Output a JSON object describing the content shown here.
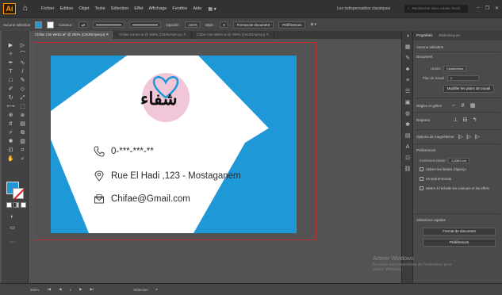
{
  "menubar": {
    "logo": "Ai",
    "items": [
      "Fichier",
      "Edition",
      "Objet",
      "Texte",
      "Sélection",
      "Effet",
      "Affichage",
      "Fenêtre",
      "Aide"
    ],
    "workspace": "Les indispensables classiques",
    "search_placeholder": "Rechercher dans Adobe Stock"
  },
  "controlbar": {
    "selection_label": "Aucune sélection",
    "stroke_label": "Contour :",
    "opacity_label": "Opacité :",
    "opacity_value": "100%",
    "style_label": "Style :",
    "doc_format_button": "Format de document",
    "preferences_button": "Préférences"
  },
  "tabs": [
    {
      "label": "Chifae Cite Web2.ai* @ 200% (CMJN/Aperçu)",
      "active": true
    },
    {
      "label": "Chifae Carte2.ai @ 150% (CMJN/Aperçu)",
      "active": false
    },
    {
      "label": "Chifae Cite Web1.ai @ 200% (CMJN/Aperçu)",
      "active": false
    }
  ],
  "card": {
    "logo_text": "شفاء",
    "phone": "0-***-***-**",
    "address": "Rue El Hadi ,123 - Mostaganem",
    "email": "Chifae@Gmail.com",
    "colors": {
      "blue": "#1f98d8",
      "pink": "#f0c6d8"
    }
  },
  "statusbar": {
    "zoom": "200%",
    "page": "1",
    "tool": "Sélection"
  },
  "panel": {
    "tabs": [
      "Propriétés",
      "Bibliothèques"
    ],
    "no_selection": "Aucune sélection",
    "document_heading": "Document",
    "units_label": "Unités :",
    "units_value": "Centimètres",
    "artboard_label": "Plan de travail :",
    "artboard_value": "1",
    "edit_artboards_button": "Modifier les plans de travail",
    "rulers_heading": "Règles et grilles",
    "guides_heading": "Repères",
    "snap_heading": "Options de magnétisme",
    "preferences_heading": "Préférences",
    "keyboard_increment_label": "Incrément clavier :",
    "keyboard_increment_value": "0,0353 cm",
    "check1": "Utiliser les limites d'aperçu",
    "check2": "Arrondi d'Arrondi",
    "check3": "Mettre à l'échelle les contours et les effets",
    "quick_actions_heading": "Sélections rapides",
    "doc_format_button": "Format de document",
    "preferences_button": "Préférences"
  },
  "watermark": {
    "title": "Activer Windows",
    "line1": "Accédez aux paramètres de l'ordinateur pour",
    "line2": "activer Windows."
  }
}
